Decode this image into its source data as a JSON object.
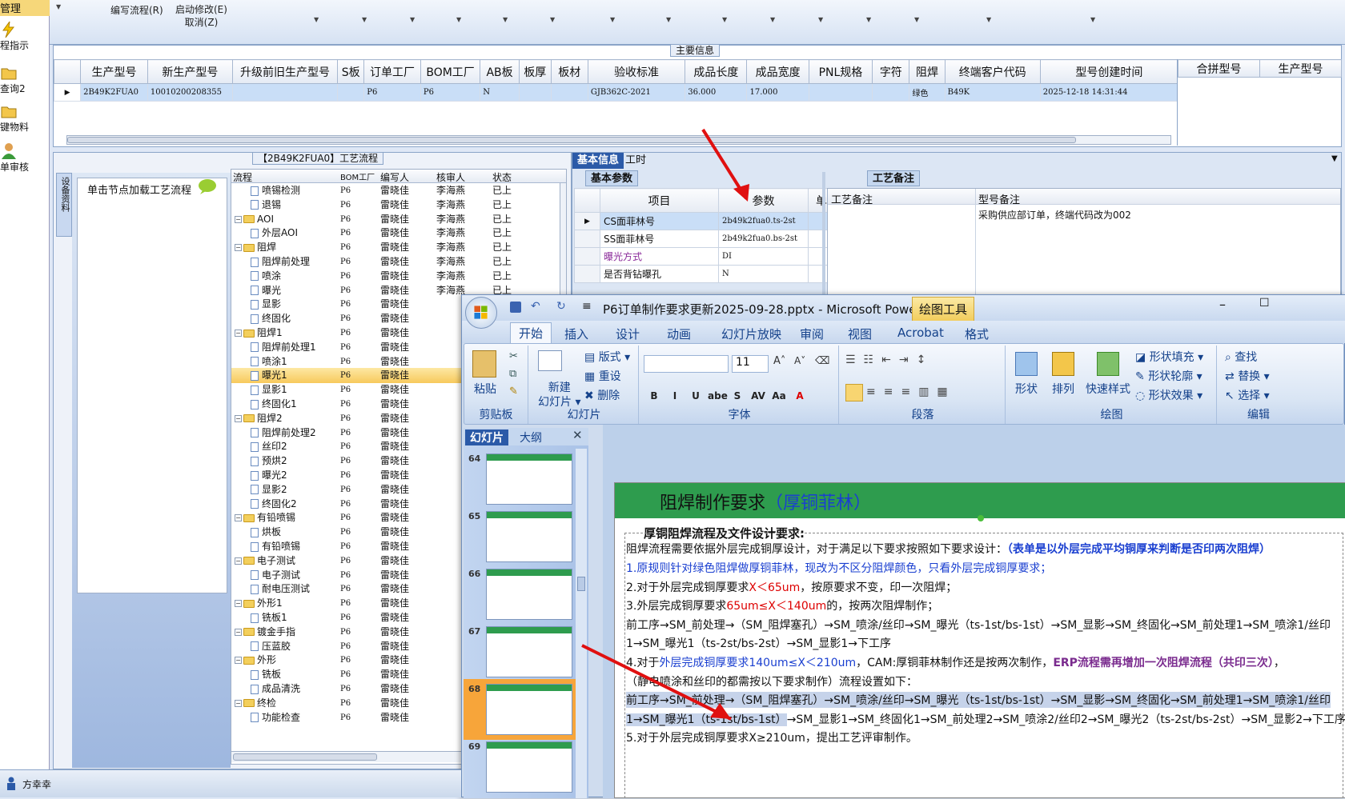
{
  "left_nav": {
    "items": [
      {
        "label": "管理"
      },
      {
        "label": "程指示"
      },
      {
        "label": "查询2"
      },
      {
        "label": "键物料"
      },
      {
        "label": "单审核"
      }
    ]
  },
  "toolbar": {
    "buttons": [
      "编写流程(R)",
      "启动修改(E)",
      "取消(Z)"
    ]
  },
  "main_info": {
    "title": "主要信息",
    "columns": [
      "生产型号",
      "新生产型号",
      "升级前旧生产型号",
      "S板",
      "订单工厂",
      "BOM工厂",
      "AB板",
      "板厚",
      "板材",
      "验收标准",
      "成品长度",
      "成品宽度",
      "PNL规格",
      "字符",
      "阻焊",
      "终端客户代码",
      "型号创建时间"
    ],
    "row": [
      "2B49K2FUA0",
      "10010200208355",
      "",
      "",
      "P6",
      "P6",
      "N",
      "",
      "",
      "GJB362C-2021",
      "36.000",
      "17.000",
      "",
      "",
      "绿色",
      "B49K",
      "2025-12-18 14:31:44"
    ],
    "right_columns": [
      "合拼型号",
      "生产型号"
    ]
  },
  "flow": {
    "title": "【2B49K2FUA0】工艺流程",
    "side_tab": "设备资料",
    "load_hint": "单击节点加载工艺流程",
    "columns": [
      "流程",
      "BOM工厂",
      "编写人",
      "核审人",
      "状态"
    ],
    "rows": [
      {
        "level": 2,
        "type": "doc",
        "name": "喷锡检测",
        "bom": "P6",
        "author": "雷晓佳",
        "reviewer": "李海燕",
        "status": "已上"
      },
      {
        "level": 2,
        "type": "doc",
        "name": "退锡",
        "bom": "P6",
        "author": "雷晓佳",
        "reviewer": "李海燕",
        "status": "已上"
      },
      {
        "level": 1,
        "type": "folder",
        "name": "AOI",
        "bom": "P6",
        "author": "雷晓佳",
        "reviewer": "李海燕",
        "status": "已上"
      },
      {
        "level": 2,
        "type": "doc",
        "name": "外层AOI",
        "bom": "P6",
        "author": "雷晓佳",
        "reviewer": "李海燕",
        "status": "已上"
      },
      {
        "level": 1,
        "type": "folder",
        "name": "阻焊",
        "bom": "P6",
        "author": "雷晓佳",
        "reviewer": "李海燕",
        "status": "已上"
      },
      {
        "level": 2,
        "type": "doc",
        "name": "阻焊前处理",
        "bom": "P6",
        "author": "雷晓佳",
        "reviewer": "李海燕",
        "status": "已上"
      },
      {
        "level": 2,
        "type": "doc",
        "name": "喷涂",
        "bom": "P6",
        "author": "雷晓佳",
        "reviewer": "李海燕",
        "status": "已上"
      },
      {
        "level": 2,
        "type": "doc",
        "name": "曝光",
        "bom": "P6",
        "author": "雷晓佳",
        "reviewer": "李海燕",
        "status": "已上"
      },
      {
        "level": 2,
        "type": "doc",
        "name": "显影",
        "bom": "P6",
        "author": "雷晓佳",
        "reviewer": "",
        "status": ""
      },
      {
        "level": 2,
        "type": "doc",
        "name": "终固化",
        "bom": "P6",
        "author": "雷晓佳",
        "reviewer": "",
        "status": ""
      },
      {
        "level": 1,
        "type": "folder",
        "name": "阻焊1",
        "bom": "P6",
        "author": "雷晓佳",
        "reviewer": "",
        "status": ""
      },
      {
        "level": 2,
        "type": "doc",
        "name": "阻焊前处理1",
        "bom": "P6",
        "author": "雷晓佳",
        "reviewer": "",
        "status": ""
      },
      {
        "level": 2,
        "type": "doc",
        "name": "喷涂1",
        "bom": "P6",
        "author": "雷晓佳",
        "reviewer": "",
        "status": ""
      },
      {
        "level": 2,
        "type": "doc",
        "name": "曝光1",
        "bom": "P6",
        "author": "雷晓佳",
        "reviewer": "",
        "status": "",
        "selected": true
      },
      {
        "level": 2,
        "type": "doc",
        "name": "显影1",
        "bom": "P6",
        "author": "雷晓佳",
        "reviewer": "",
        "status": ""
      },
      {
        "level": 2,
        "type": "doc",
        "name": "终固化1",
        "bom": "P6",
        "author": "雷晓佳",
        "reviewer": "",
        "status": ""
      },
      {
        "level": 1,
        "type": "folder",
        "name": "阻焊2",
        "bom": "P6",
        "author": "雷晓佳",
        "reviewer": "",
        "status": ""
      },
      {
        "level": 2,
        "type": "doc",
        "name": "阻焊前处理2",
        "bom": "P6",
        "author": "雷晓佳",
        "reviewer": "",
        "status": ""
      },
      {
        "level": 2,
        "type": "doc",
        "name": "丝印2",
        "bom": "P6",
        "author": "雷晓佳",
        "reviewer": "",
        "status": ""
      },
      {
        "level": 2,
        "type": "doc",
        "name": "预烘2",
        "bom": "P6",
        "author": "雷晓佳",
        "reviewer": "",
        "status": ""
      },
      {
        "level": 2,
        "type": "doc",
        "name": "曝光2",
        "bom": "P6",
        "author": "雷晓佳",
        "reviewer": "",
        "status": ""
      },
      {
        "level": 2,
        "type": "doc",
        "name": "显影2",
        "bom": "P6",
        "author": "雷晓佳",
        "reviewer": "",
        "status": ""
      },
      {
        "level": 2,
        "type": "doc",
        "name": "终固化2",
        "bom": "P6",
        "author": "雷晓佳",
        "reviewer": "",
        "status": ""
      },
      {
        "level": 1,
        "type": "folder",
        "name": "有铅喷锡",
        "bom": "P6",
        "author": "雷晓佳",
        "reviewer": "",
        "status": ""
      },
      {
        "level": 2,
        "type": "doc",
        "name": "烘板",
        "bom": "P6",
        "author": "雷晓佳",
        "reviewer": "",
        "status": ""
      },
      {
        "level": 2,
        "type": "doc",
        "name": "有铅喷锡",
        "bom": "P6",
        "author": "雷晓佳",
        "reviewer": "",
        "status": ""
      },
      {
        "level": 1,
        "type": "folder",
        "name": "电子测试",
        "bom": "P6",
        "author": "雷晓佳",
        "reviewer": "",
        "status": ""
      },
      {
        "level": 2,
        "type": "doc",
        "name": "电子测试",
        "bom": "P6",
        "author": "雷晓佳",
        "reviewer": "",
        "status": ""
      },
      {
        "level": 2,
        "type": "doc",
        "name": "耐电压测试",
        "bom": "P6",
        "author": "雷晓佳",
        "reviewer": "",
        "status": ""
      },
      {
        "level": 1,
        "type": "folder",
        "name": "外形1",
        "bom": "P6",
        "author": "雷晓佳",
        "reviewer": "",
        "status": ""
      },
      {
        "level": 2,
        "type": "doc",
        "name": "铣板1",
        "bom": "P6",
        "author": "雷晓佳",
        "reviewer": "",
        "status": ""
      },
      {
        "level": 1,
        "type": "folder",
        "name": "镀金手指",
        "bom": "P6",
        "author": "雷晓佳",
        "reviewer": "",
        "status": ""
      },
      {
        "level": 2,
        "type": "doc",
        "name": "压蓝胶",
        "bom": "P6",
        "author": "雷晓佳",
        "reviewer": "",
        "status": ""
      },
      {
        "level": 1,
        "type": "folder",
        "name": "外形",
        "bom": "P6",
        "author": "雷晓佳",
        "reviewer": "",
        "status": ""
      },
      {
        "level": 2,
        "type": "doc",
        "name": "铣板",
        "bom": "P6",
        "author": "雷晓佳",
        "reviewer": "",
        "status": ""
      },
      {
        "level": 2,
        "type": "doc",
        "name": "成品清洗",
        "bom": "P6",
        "author": "雷晓佳",
        "reviewer": "",
        "status": ""
      },
      {
        "level": 1,
        "type": "folder",
        "name": "终检",
        "bom": "P6",
        "author": "雷晓佳",
        "reviewer": "",
        "status": ""
      },
      {
        "level": 2,
        "type": "doc",
        "name": "功能检查",
        "bom": "P6",
        "author": "雷晓佳",
        "reviewer": "",
        "status": ""
      }
    ]
  },
  "detail": {
    "tabs": [
      "基本信息",
      "工时"
    ],
    "basic_tab": "基本参数",
    "remark_tab": "工艺备注",
    "param_columns": [
      "项目",
      "参数",
      "单位"
    ],
    "params": [
      {
        "item": "CS面菲林号",
        "value": "2b49k2fua0.ts-2st",
        "unit": "",
        "highlight": true
      },
      {
        "item": "SS面菲林号",
        "value": "2b49k2fua0.bs-2st",
        "unit": ""
      },
      {
        "item": "曝光方式",
        "value": "DI",
        "unit": "",
        "purple": true
      },
      {
        "item": "是否背钻曝孔",
        "value": "N",
        "unit": ""
      }
    ],
    "remark_columns": [
      "工艺备注",
      "型号备注"
    ],
    "model_remark": "采购供应部订单，终端代码改为002"
  },
  "ppt": {
    "title": "P6订单制作要求更新2025-09-28.pptx - Microsoft Power...",
    "context_tab": "绘图工具",
    "tabs": [
      "开始",
      "插入",
      "设计",
      "动画",
      "幻灯片放映",
      "审阅",
      "视图",
      "Acrobat",
      "格式"
    ],
    "groups": {
      "clipboard": {
        "label": "剪贴板",
        "paste": "粘贴"
      },
      "slides": {
        "label": "幻灯片",
        "new": "新建",
        "new2": "幻灯片",
        "layout": "版式",
        "reset": "重设",
        "delete": "删除"
      },
      "font": {
        "label": "字体",
        "size": "11",
        "buttons": [
          "B",
          "I",
          "U",
          "abe",
          "S",
          "AV",
          "Aa",
          "A"
        ]
      },
      "paragraph": {
        "label": "段落"
      },
      "drawing": {
        "label": "绘图",
        "shape": "形状",
        "arrange": "排列",
        "quick": "快速样式",
        "fill": "形状填充",
        "outline": "形状轮廓",
        "effect": "形状效果"
      },
      "editing": {
        "label": "编辑",
        "find": "查找",
        "replace": "替换",
        "select": "选择"
      }
    },
    "pane_tabs": [
      "幻灯片",
      "大纲"
    ],
    "thumbs": [
      "64",
      "65",
      "66",
      "67",
      "68",
      "69"
    ],
    "slide": {
      "title": "阻焊制作要求",
      "title_paren": "（厚铜菲林）",
      "subtitle": "厚铜阻焊流程及文件设计要求:",
      "lines": [
        {
          "a": "阻焊流程需要依据外层完成铜厚设计，对于满足以下要求按照如下要求设计：",
          "b": "（表单是以外层完成平均铜厚来判断是否印两次阻焊）"
        },
        {
          "a": "1.原规则针对绿色阻焊做厚铜菲林，现改为不区分阻焊颜色，只看外层完成铜厚要求；"
        },
        {
          "a": "2.对于外层完成铜厚要求",
          "b": "X＜65um",
          "c": "，按原要求不变，印一次阻焊；"
        },
        {
          "a": "3.外层完成铜厚要求",
          "b": "65um≤X＜140um",
          "c": "的，按两次阻焊制作；"
        },
        {
          "a": "前工序→SM_前处理→（SM_阻焊塞孔）→SM_喷涂/丝印→SM_曝光（ts-1st/bs-1st）→SM_显影→SM_终固化→SM_前处理1→SM_喷涂1/丝印"
        },
        {
          "a": "1→SM_曝光1（ts-2st/bs-2st）→SM_显影1→下工序"
        },
        {
          "a": "4.对于",
          "b": "外层完成铜厚要求140um≤X＜210um",
          "c": "，CAM:厚铜菲林制作还是按两次制作，",
          "d": "ERP流程需再增加一次阻焊流程（共印三次）",
          "e": "，"
        },
        {
          "a": "（静电喷涂和丝印的都需按以下要求制作）流程设置如下："
        },
        {
          "a": "前工序→SM_前处理→（SM_阻焊塞孔）→SM_喷涂/丝印→SM_曝光（ts-1st/bs-1st）→SM_显影→SM_终固化→SM_前处理1→SM_喷涂1/丝印"
        },
        {
          "a": "1→SM_曝光1（ts-1st/bs-1st）",
          "b": "→SM_显影1→SM_终固化1→SM_前处理2→SM_喷涂2/丝印2→SM_曝光2（ts-2st/bs-2st）→SM_显影2→下工序"
        },
        {
          "a": "5.对于外层完成铜厚要求X≥210um，提出工艺评审制作。"
        }
      ]
    }
  },
  "status": {
    "user": "方幸幸"
  }
}
